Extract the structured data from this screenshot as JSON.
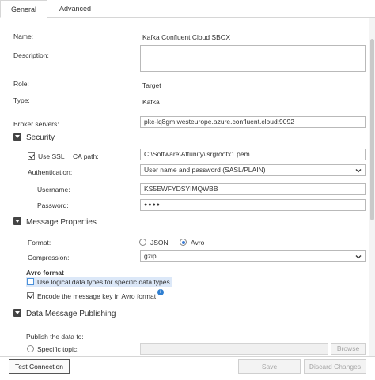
{
  "tabs": [
    {
      "label": "General",
      "active": true
    },
    {
      "label": "Advanced",
      "active": false
    }
  ],
  "general": {
    "name_label": "Name:",
    "name_value": "Kafka Confluent Cloud SBOX",
    "description_label": "Description:",
    "description_value": "",
    "role_label": "Role:",
    "role_value": "Target",
    "type_label": "Type:",
    "type_value": "Kafka",
    "broker_label": "Broker servers:",
    "broker_value": "pkc-lq8gm.westeurope.azure.confluent.cloud:9092"
  },
  "security": {
    "title": "Security",
    "use_ssl_label": "Use SSL",
    "use_ssl_checked": true,
    "ca_path_label": "CA path:",
    "ca_path_value": "C:\\Software\\Attunity\\isrgrootx1.pem",
    "authentication_label": "Authentication:",
    "authentication_value": "User name and password (SASL/PLAIN)",
    "username_label": "Username:",
    "username_value": "KS5EWFYDSYIMQWBB",
    "password_label": "Password:",
    "password_value": "●●●●"
  },
  "message_properties": {
    "title": "Message Properties",
    "format_label": "Format:",
    "format_options": [
      "JSON",
      "Avro"
    ],
    "format_selected": "Avro",
    "compression_label": "Compression:",
    "compression_value": "gzip",
    "avro_format_title": "Avro format",
    "logical_types_label": "Use logical data types for specific data types",
    "logical_types_checked": false,
    "encode_key_label": "Encode the message key in Avro format",
    "encode_key_checked": true
  },
  "data_publishing": {
    "title": "Data Message Publishing",
    "publish_label": "Publish the data to:",
    "specific_topic_label": "Specific topic:",
    "browse_label": "Browse"
  },
  "footer": {
    "test_connection_label": "Test Connection",
    "save_label": "Save",
    "discard_label": "Discard Changes"
  },
  "colors": {
    "highlight": "#dce8f8",
    "accent": "#3a7bd5",
    "info_icon": "#2f7fd1"
  }
}
